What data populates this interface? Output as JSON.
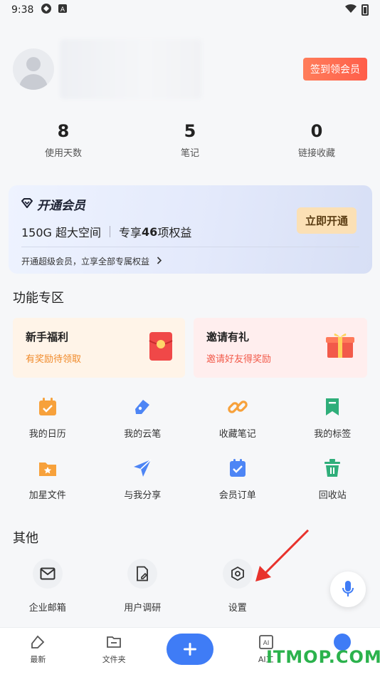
{
  "status_bar": {
    "time": "9:38",
    "icons": [
      "app-icon",
      "a-icon"
    ]
  },
  "profile": {
    "signin_label": "签到领会员"
  },
  "stats": [
    {
      "value": "8",
      "label": "使用天数"
    },
    {
      "value": "5",
      "label": "笔记"
    },
    {
      "value": "0",
      "label": "链接收藏"
    }
  ],
  "vip": {
    "title": "开通会员",
    "space": "150G 超大空间",
    "benefits_prefix": "专享",
    "benefits_count": "46",
    "benefits_suffix": "项权益",
    "button": "立即开通",
    "footer": "开通超级会员，立享全部专属权益"
  },
  "features": {
    "title": "功能专区",
    "promos": [
      {
        "title": "新手福利",
        "subtitle": "有奖励待领取"
      },
      {
        "title": "邀请有礼",
        "subtitle": "邀请好友得奖励"
      }
    ],
    "row1": [
      {
        "label": "我的日历",
        "icon": "calendar-icon"
      },
      {
        "label": "我的云笔",
        "icon": "pen-icon"
      },
      {
        "label": "收藏笔记",
        "icon": "link-icon"
      },
      {
        "label": "我的标签",
        "icon": "bookmark-icon"
      }
    ],
    "row2": [
      {
        "label": "加星文件",
        "icon": "star-folder-icon"
      },
      {
        "label": "与我分享",
        "icon": "send-icon"
      },
      {
        "label": "会员订单",
        "icon": "order-icon"
      },
      {
        "label": "回收站",
        "icon": "trash-icon"
      }
    ]
  },
  "others": {
    "title": "其他",
    "items": [
      {
        "label": "企业邮箱",
        "icon": "mail-icon"
      },
      {
        "label": "用户调研",
        "icon": "survey-icon"
      },
      {
        "label": "设置",
        "icon": "settings-icon"
      }
    ]
  },
  "bottom_nav": [
    {
      "label": "最新",
      "icon": "latest-icon"
    },
    {
      "label": "文件夹",
      "icon": "folder-icon"
    },
    {
      "label": "",
      "icon": "plus-icon"
    },
    {
      "label": "AI工",
      "icon": "ai-icon"
    },
    {
      "label": "",
      "icon": "me-icon"
    }
  ],
  "watermark": "ITMOP.COM",
  "colors": {
    "accent": "#3f7cf6",
    "signin": "#ff6a4e",
    "vip_button": "#fbe0b5",
    "promo_orange": "#f08a2a",
    "promo_red": "#f25a4a"
  }
}
